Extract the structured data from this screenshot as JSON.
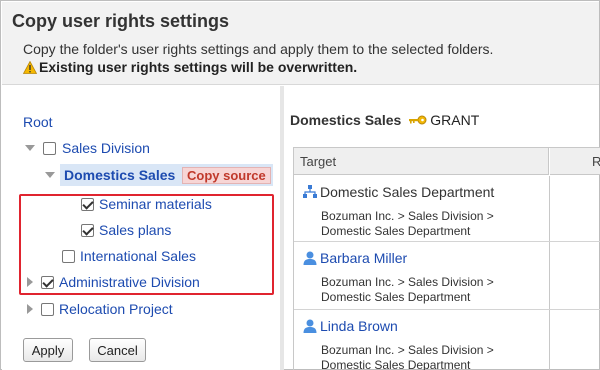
{
  "page": {
    "title": "Copy user rights settings",
    "description": "Copy the folder's user rights settings and apply them to the selected folders.",
    "warning": "Existing user rights settings will be overwritten."
  },
  "tree": {
    "root_label": "Root",
    "items": [
      {
        "label": "Sales Division",
        "expanded": true,
        "checked": false
      },
      {
        "label": "Domestics Sales",
        "badge": "Copy source",
        "expanded": true,
        "selected": true
      },
      {
        "label": "Seminar materials",
        "checked": true
      },
      {
        "label": "Sales plans",
        "checked": true
      },
      {
        "label": "International Sales",
        "checked": false
      },
      {
        "label": "Administrative Division",
        "expanded": false,
        "checked": true
      },
      {
        "label": "Relocation Project",
        "expanded": false,
        "checked": false
      }
    ]
  },
  "buttons": {
    "apply": "Apply",
    "cancel": "Cancel"
  },
  "right": {
    "folder_name": "Domestics Sales",
    "grant_label": "GRANT",
    "columns": [
      "Target",
      "R"
    ],
    "rows": [
      {
        "type": "organization",
        "name": "Domestic Sales Department",
        "path1": "Bozuman Inc. > Sales Division >",
        "path2": "Domestic Sales Department"
      },
      {
        "type": "user",
        "name": "Barbara Miller",
        "path1": "Bozuman Inc. > Sales Division >",
        "path2": "Domestic Sales Department"
      },
      {
        "type": "user",
        "name": "Linda Brown",
        "path1": "Bozuman Inc. > Sales Division >",
        "path2": "Domestic Sales Department"
      }
    ]
  },
  "colors": {
    "link": "#1d4bb0",
    "selected_bg": "#d9e6f6",
    "highlight_border": "#e0242f",
    "badge_text": "#c0392b",
    "badge_bg": "#f7d5d5"
  }
}
